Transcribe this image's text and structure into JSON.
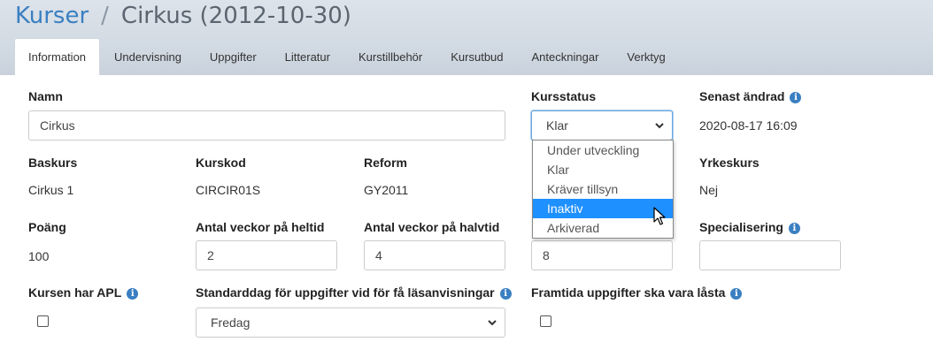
{
  "breadcrumb": {
    "root": "Kurser",
    "separator": "/",
    "current": "Cirkus (2012-10-30)"
  },
  "tabs": [
    {
      "label": "Information",
      "active": true
    },
    {
      "label": "Undervisning"
    },
    {
      "label": "Uppgifter"
    },
    {
      "label": "Litteratur"
    },
    {
      "label": "Kurstillbehör"
    },
    {
      "label": "Kursutbud"
    },
    {
      "label": "Anteckningar"
    },
    {
      "label": "Verktyg"
    }
  ],
  "form": {
    "namn_label": "Namn",
    "namn_value": "Cirkus",
    "kursstatus_label": "Kursstatus",
    "kursstatus_value": "Klar",
    "kursstatus_options": [
      "Under utveckling",
      "Klar",
      "Kräver tillsyn",
      "Inaktiv",
      "Arkiverad"
    ],
    "kursstatus_highlighted": "Inaktiv",
    "senast_andrad_label": "Senast ändrad",
    "senast_andrad_value": "2020-08-17 16:09",
    "baskurs_label": "Baskurs",
    "baskurs_value": "Cirkus 1",
    "kurskod_label": "Kurskod",
    "kurskod_value": "CIRCIR01S",
    "reform_label": "Reform",
    "reform_value": "GY2011",
    "yrkeskurs_label": "Yrkeskurs",
    "yrkeskurs_value": "Nej",
    "poang_label": "Poäng",
    "poang_value": "100",
    "veckor_heltid_label": "Antal veckor på heltid",
    "veckor_heltid_value": "2",
    "veckor_halvtid_label": "Antal veckor på halvtid",
    "veckor_halvtid_value": "4",
    "hidden_field_value": "8",
    "specialisering_label": "Specialisering",
    "specialisering_value": "",
    "apl_label": "Kursen har APL",
    "standarddag_label": "Standarddag för uppgifter vid för få läsanvisningar",
    "standarddag_value": "Fredag",
    "framtida_label": "Framtida uppgifter ska vara låsta"
  },
  "colors": {
    "accent": "#3a7fc1",
    "selected": "#1e90ff"
  },
  "icons": {
    "info": "info-icon",
    "chevron": "chevron-down-icon",
    "cursor": "mouse-pointer-icon"
  }
}
